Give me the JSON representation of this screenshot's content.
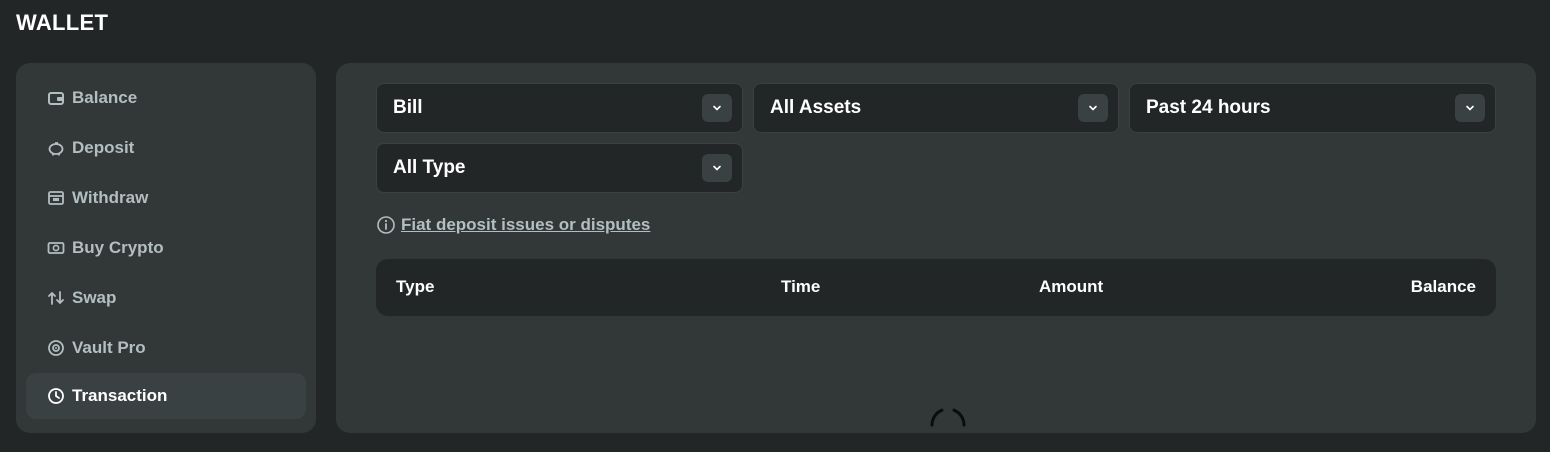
{
  "header": {
    "title": "WALLET"
  },
  "sidebar": {
    "items": [
      {
        "label": "Balance",
        "icon": "wallet-icon"
      },
      {
        "label": "Deposit",
        "icon": "piggy-bank-icon"
      },
      {
        "label": "Withdraw",
        "icon": "withdraw-icon"
      },
      {
        "label": "Buy Crypto",
        "icon": "buy-crypto-icon"
      },
      {
        "label": "Swap",
        "icon": "swap-icon"
      },
      {
        "label": "Vault Pro",
        "icon": "vault-icon"
      },
      {
        "label": "Transaction",
        "icon": "transaction-icon",
        "active": true
      }
    ]
  },
  "filters": {
    "bill": "Bill",
    "assets": "All Assets",
    "period": "Past 24 hours",
    "type": "All Type"
  },
  "notice": {
    "link_text": "Fiat deposit issues or disputes"
  },
  "table": {
    "columns": [
      "Type",
      "Time",
      "Amount",
      "Balance"
    ]
  },
  "colors": {
    "page_bg": "#232626",
    "panel_bg": "#323738",
    "active_bg": "#3a4142",
    "muted_text": "#b3bec1"
  }
}
